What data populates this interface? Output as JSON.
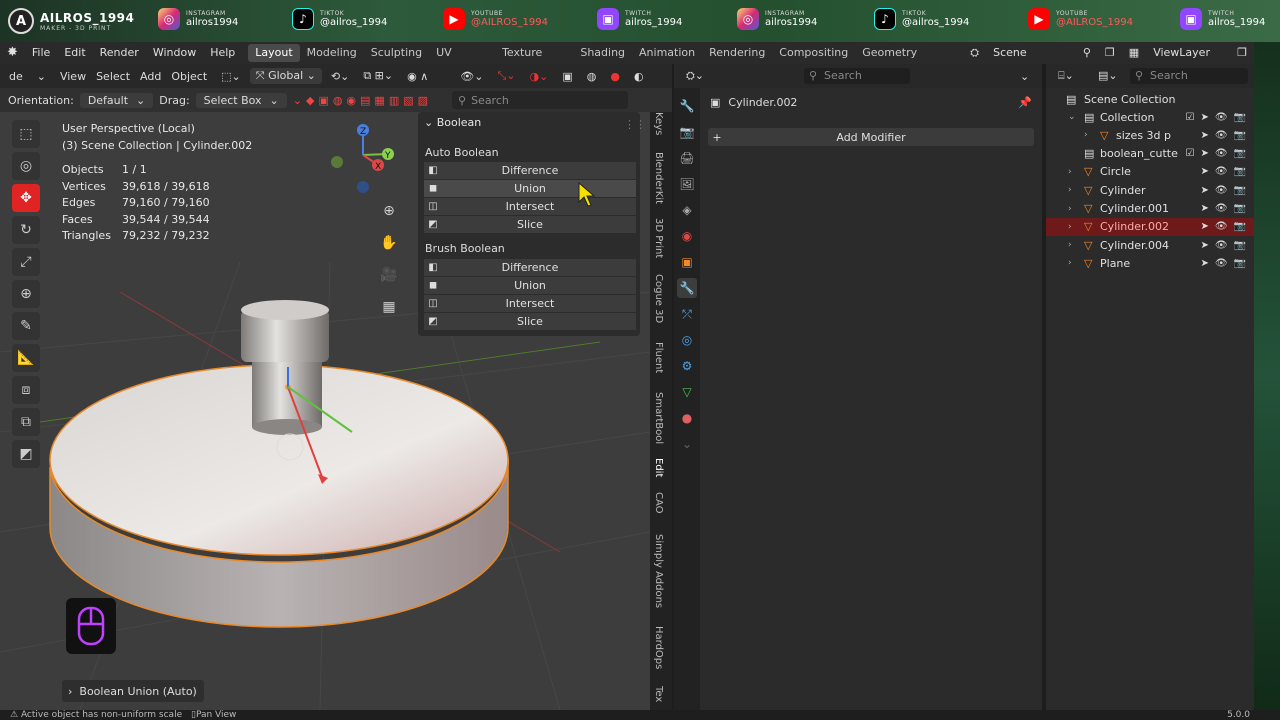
{
  "brand": {
    "name": "AILROS_1994",
    "sub": "MAKER - 3D PRINT",
    "initial": "A"
  },
  "socials": [
    {
      "platform": "INSTAGRAM",
      "handle": "ailros1994",
      "icon": "instagram-icon"
    },
    {
      "platform": "TIKTOK",
      "handle": "@ailros_1994",
      "icon": "tiktok-icon"
    },
    {
      "platform": "YOUTUBE",
      "handle": "@AILROS_1994",
      "icon": "youtube-icon"
    },
    {
      "platform": "TWITCH",
      "handle": "ailros_1994",
      "icon": "twitch-icon"
    },
    {
      "platform": "INSTAGRAM",
      "handle": "ailros1994",
      "icon": "instagram-icon"
    },
    {
      "platform": "TIKTOK",
      "handle": "@ailros_1994",
      "icon": "tiktok-icon"
    },
    {
      "platform": "YOUTUBE",
      "handle": "@AILROS_1994",
      "icon": "youtube-icon"
    },
    {
      "platform": "TWITCH",
      "handle": "ailros_1994",
      "icon": "twitch-icon"
    }
  ],
  "menu": [
    "File",
    "Edit",
    "Render",
    "Window",
    "Help"
  ],
  "workspaces": [
    "Layout",
    "Modeling",
    "Sculpting",
    "UV Editing",
    "Texture Paint",
    "Shading",
    "Animation",
    "Rendering",
    "Compositing",
    "Geometry Nodes"
  ],
  "scene_label": "Scene",
  "viewlayer_label": "ViewLayer",
  "viewport_header": {
    "mode": "de",
    "menus": [
      "View",
      "Select",
      "Add",
      "Object"
    ],
    "transform": "Global"
  },
  "tool_settings": {
    "orientation_label": "Orientation:",
    "orientation": "Default",
    "drag_label": "Drag:",
    "drag": "Select Box",
    "search_placeholder": "Search"
  },
  "overlay": {
    "perspective": "User Perspective (Local)",
    "collection": "(3) Scene Collection | Cylinder.002"
  },
  "stats": [
    {
      "k": "Objects",
      "v": "1 / 1"
    },
    {
      "k": "Vertices",
      "v": "39,618 / 39,618"
    },
    {
      "k": "Edges",
      "v": "79,160 / 79,160"
    },
    {
      "k": "Faces",
      "v": "39,544 / 39,544"
    },
    {
      "k": "Triangles",
      "v": "79,232 / 79,232"
    }
  ],
  "boolean_panel": {
    "title": "Boolean",
    "auto_label": "Auto Boolean",
    "brush_label": "Brush Boolean",
    "auto": [
      "Difference",
      "Union",
      "Intersect",
      "Slice"
    ],
    "brush": [
      "Difference",
      "Union",
      "Intersect",
      "Slice"
    ]
  },
  "side_tabs": [
    "Keys",
    "BlenderKit",
    "3D Print",
    "Cogue 3D",
    "Fluent",
    "SmartBool",
    "Edit",
    "CAO",
    "Simply Addons",
    "HardOps",
    "Tex"
  ],
  "redo_panel": "Boolean Union (Auto)",
  "properties": {
    "search_placeholder": "Search",
    "object": "Cylinder.002",
    "add_modifier": "Add Modifier"
  },
  "outliner": {
    "search_placeholder": "Search",
    "root": "Scene Collection",
    "rows": [
      {
        "name": "Collection",
        "level": 1,
        "icon": "collection-icon",
        "sel": false
      },
      {
        "name": "sizes 3d p",
        "level": 2,
        "icon": "mesh-icon",
        "sel": false
      },
      {
        "name": "boolean_cutte",
        "level": 1,
        "icon": "collection-icon",
        "sel": false
      },
      {
        "name": "Circle",
        "level": 1,
        "icon": "mesh-icon",
        "sel": false
      },
      {
        "name": "Cylinder",
        "level": 1,
        "icon": "mesh-icon",
        "sel": false
      },
      {
        "name": "Cylinder.001",
        "level": 1,
        "icon": "mesh-icon",
        "sel": false
      },
      {
        "name": "Cylinder.002",
        "level": 1,
        "icon": "mesh-icon",
        "sel": true
      },
      {
        "name": "Cylinder.004",
        "level": 1,
        "icon": "mesh-icon",
        "sel": false
      },
      {
        "name": "Plane",
        "level": 1,
        "icon": "mesh-icon",
        "sel": false
      }
    ]
  },
  "status": {
    "left": "Active object has non-uniform scale",
    "pan": "Pan View",
    "version": "5.0.0"
  }
}
